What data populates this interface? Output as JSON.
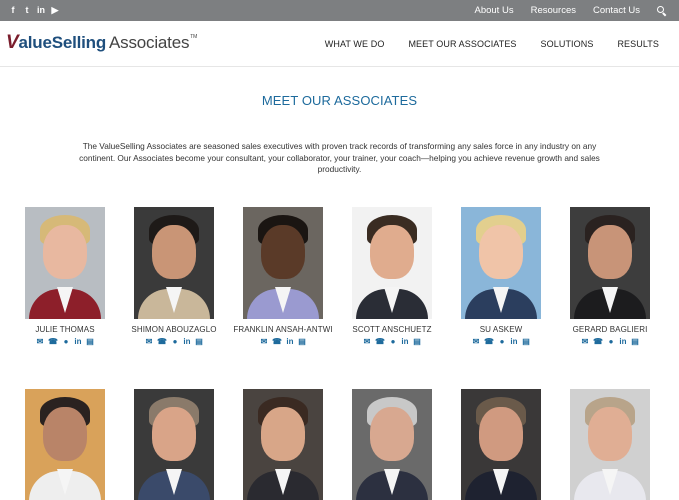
{
  "topbar": {
    "social": [
      {
        "icon": "facebook-icon",
        "glyph": "f"
      },
      {
        "icon": "twitter-icon",
        "glyph": "t"
      },
      {
        "icon": "linkedin-icon",
        "glyph": "in"
      },
      {
        "icon": "youtube-icon",
        "glyph": "▶"
      }
    ],
    "links": [
      "About Us",
      "Resources",
      "Contact Us"
    ]
  },
  "header": {
    "logo": {
      "v": "V",
      "rest": "alueSelling",
      "associates": "Associates",
      "tm": "TM"
    },
    "nav": [
      "WHAT WE DO",
      "MEET OUR ASSOCIATES",
      "SOLUTIONS",
      "RESULTS"
    ]
  },
  "main": {
    "title": "MEET OUR ASSOCIATES",
    "intro": "The ValueSelling Associates are seasoned sales executives with proven track records of transforming any sales force in any industry on any continent. Our Associates become your consultant, your collaborator, your trainer, your coach—helping you achieve revenue growth and sales productivity."
  },
  "contact_icons": {
    "email": "✉",
    "phone": "☎",
    "web": "●",
    "linkedin": "in",
    "pdf": "▤"
  },
  "associates": [
    {
      "name": "JULIE THOMAS",
      "has_web": true,
      "bg": "#b8bdc2",
      "skin": "#e8b8a0",
      "hair": "#d6b978",
      "clothes": "#8d1f2a"
    },
    {
      "name": "SHIMON ABOUZAGLO",
      "has_web": true,
      "bg": "#3a3a3a",
      "skin": "#c99576",
      "hair": "#1e1a18",
      "clothes": "#c9b79a"
    },
    {
      "name": "FRANKLIN ANSAH-ANTWI",
      "has_web": false,
      "bg": "#6b6660",
      "skin": "#5a3a28",
      "hair": "#1a1512",
      "clothes": "#9a9ad0"
    },
    {
      "name": "SCOTT ANSCHUETZ",
      "has_web": true,
      "bg": "#f2f2f2",
      "skin": "#e0ac8e",
      "hair": "#3a2c22",
      "clothes": "#2a2d36"
    },
    {
      "name": "SU ASKEW",
      "has_web": true,
      "bg": "#8ab6d9",
      "skin": "#f0c4a8",
      "hair": "#e2cf8e",
      "clothes": "#2b3e5e"
    },
    {
      "name": "GERARD BAGLIERI",
      "has_web": true,
      "bg": "#3d3d3d",
      "skin": "#c89478",
      "hair": "#2a2220",
      "clothes": "#1c1c1e"
    },
    {
      "name": "",
      "has_web": false,
      "bg": "#d9a25a",
      "skin": "#b98468",
      "hair": "#2a2220",
      "clothes": "#eeeeee"
    },
    {
      "name": "",
      "has_web": false,
      "bg": "#3a3a3a",
      "skin": "#d9a488",
      "hair": "#8a7a6a",
      "clothes": "#3a4a6a"
    },
    {
      "name": "",
      "has_web": false,
      "bg": "#4a4440",
      "skin": "#d8a688",
      "hair": "#3a2a22",
      "clothes": "#2a2a30"
    },
    {
      "name": "",
      "has_web": false,
      "bg": "#6a6a6a",
      "skin": "#d8a890",
      "hair": "#c8c8c8",
      "clothes": "#2c3040"
    },
    {
      "name": "",
      "has_web": false,
      "bg": "#3a3838",
      "skin": "#d09a80",
      "hair": "#6a5a4a",
      "clothes": "#1e2230"
    },
    {
      "name": "",
      "has_web": false,
      "bg": "#d0d0d0",
      "skin": "#e0ae94",
      "hair": "#b8a48a",
      "clothes": "#e8e8ee"
    }
  ]
}
